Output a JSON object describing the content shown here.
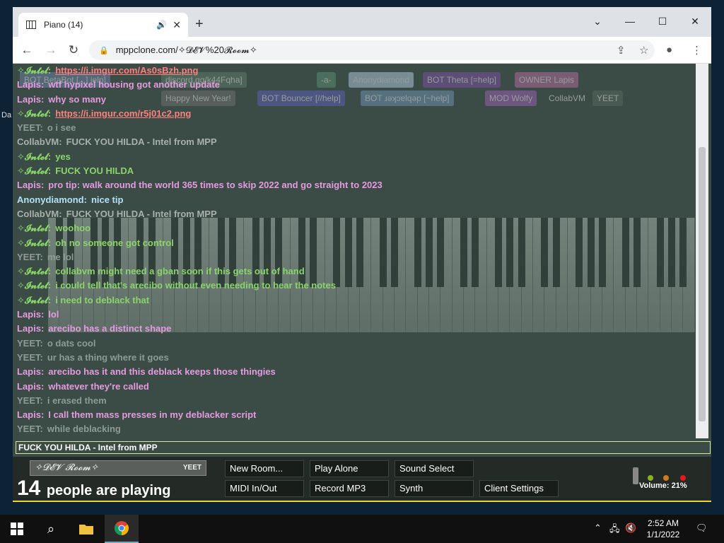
{
  "desktop": {
    "partial_label": "Da"
  },
  "browser": {
    "tab_title": "Piano (14)",
    "url": "mppclone.com/✧𝓓𝓔𝓥%20𝓡𝓸𝓸𝓶✧"
  },
  "userbar": {
    "users": [
      {
        "badge": "BOT",
        "name": "BetaBot [...] ielp]",
        "color": "#6b7fa0"
      },
      {
        "badge": "",
        "name": "discord.gg/k44Fqha]",
        "color": "#5d7a6a"
      },
      {
        "badge": "",
        "name": "-a-",
        "color": "#5a8a6f"
      },
      {
        "badge": "",
        "name": "Anonydiamond",
        "color": "#a9c2d6"
      },
      {
        "badge": "BOT",
        "name": "Theta [=help]",
        "color": "#7a4fa0"
      },
      {
        "badge": "OWNER",
        "name": "Lapis",
        "color": "#b06a9c"
      },
      {
        "badge": "",
        "name": "Happy New Year!",
        "color": "#6f6f6f"
      },
      {
        "badge": "BOT",
        "name": "Bouncer [//help]",
        "color": "#5b5fb0"
      },
      {
        "badge": "BOT",
        "name": "ɹǝʞɔɐlqǝp [~help]",
        "color": "#6f8fb0"
      },
      {
        "badge": "MOD",
        "name": "Wolfy",
        "color": "#9a5fb0"
      },
      {
        "badge": "",
        "name": "CollabVM",
        "color": "#3b4c46"
      },
      {
        "badge": "",
        "name": "YEET",
        "color": "#56675f"
      }
    ]
  },
  "chat": {
    "messages": [
      {
        "name": "✧𝓘𝓷𝓽𝓮𝓵:",
        "text": "https://i.imgur.com/As0sBzh.png",
        "color": "#8ad36a",
        "link": true
      },
      {
        "name": "Lapis:",
        "text": "wtf hypixel housing got another update",
        "color": "#e49ade"
      },
      {
        "name": "Lapis:",
        "text": "why so many",
        "color": "#e49ade"
      },
      {
        "name": "✧𝓘𝓷𝓽𝓮𝓵:",
        "text": "https://i.imgur.com/r5j01c2.png",
        "color": "#8ad36a",
        "link": true
      },
      {
        "name": "YEET:",
        "text": "o i see",
        "color": "#8e9a94"
      },
      {
        "name": "CollabVM:",
        "text": "FUCK YOU HILDA - Intel from MPP",
        "color": "#a7b0ac"
      },
      {
        "name": "✧𝓘𝓷𝓽𝓮𝓵:",
        "text": "yes",
        "color": "#8ad36a"
      },
      {
        "name": "✧𝓘𝓷𝓽𝓮𝓵:",
        "text": "FUCK YOU HILDA",
        "color": "#8ad36a"
      },
      {
        "name": "Lapis:",
        "text": "pro tip: walk around the world 365 times to skip 2022 and go straight to 2023",
        "color": "#e49ade"
      },
      {
        "name": "Anonydiamond:",
        "text": "nice tip",
        "color": "#b4e0f6"
      },
      {
        "name": "CollabVM:",
        "text": "FUCK YOU HILDA - Intel from MPP",
        "color": "#a7b0ac"
      },
      {
        "name": "✧𝓘𝓷𝓽𝓮𝓵:",
        "text": "woohoo",
        "color": "#8ad36a"
      },
      {
        "name": "✧𝓘𝓷𝓽𝓮𝓵:",
        "text": "oh no someone got control",
        "color": "#8ad36a"
      },
      {
        "name": "YEET:",
        "text": "me lol",
        "color": "#8e9a94"
      },
      {
        "name": "✧𝓘𝓷𝓽𝓮𝓵:",
        "text": "collabvm might need a gban soon if this gets out of hand",
        "color": "#8ad36a"
      },
      {
        "name": "✧𝓘𝓷𝓽𝓮𝓵:",
        "text": "i could tell that's arecibo without even needing to hear the notes",
        "color": "#8ad36a"
      },
      {
        "name": "✧𝓘𝓷𝓽𝓮𝓵:",
        "text": "i need to deblack that",
        "color": "#8ad36a"
      },
      {
        "name": "Lapis:",
        "text": "lol",
        "color": "#e49ade"
      },
      {
        "name": "Lapis:",
        "text": "arecibo has a distinct shape",
        "color": "#e49ade"
      },
      {
        "name": "YEET:",
        "text": "o dats cool",
        "color": "#8e9a94"
      },
      {
        "name": "YEET:",
        "text": "ur has a thing where it goes",
        "color": "#8e9a94"
      },
      {
        "name": "Lapis:",
        "text": "arecibo has it and this deblack keeps those thingies",
        "color": "#e49ade"
      },
      {
        "name": "Lapis:",
        "text": "whatever they're called",
        "color": "#e49ade"
      },
      {
        "name": "YEET:",
        "text": "i erased them",
        "color": "#8e9a94"
      },
      {
        "name": "Lapis:",
        "text": "I call them mass presses in my deblacker script",
        "color": "#e49ade"
      },
      {
        "name": "YEET:",
        "text": "while deblacking",
        "color": "#8e9a94"
      }
    ],
    "input_value": "FUCK YOU HILDA - Intel from MPP"
  },
  "bottom": {
    "room_name": "✧𝓓𝓔𝓥 𝓡𝓸𝓸𝓶✧",
    "room_count": "YEET",
    "people_count": "14",
    "people_text": "people are playing",
    "buttons": {
      "new_room": "New Room...",
      "play_alone": "Play Alone",
      "sound_select": "Sound Select",
      "midi": "MIDI In/Out",
      "record_mp3": "Record MP3",
      "synth": "Synth",
      "client_settings": "Client Settings"
    },
    "volume": "Volume: 21%"
  },
  "taskbar": {
    "time": "2:52 AM",
    "date": "1/1/2022"
  }
}
